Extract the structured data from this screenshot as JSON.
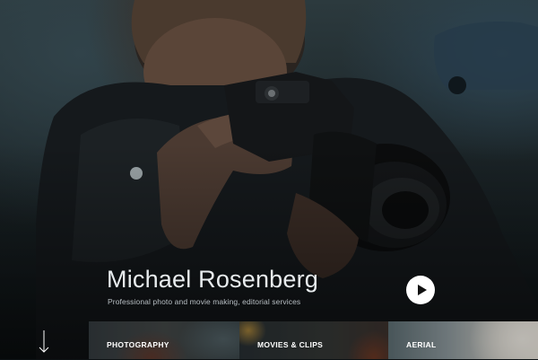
{
  "hero": {
    "name": "Michael Rosenberg",
    "tagline": "Professional photo and movie making, editorial services",
    "play_icon": "play-icon",
    "photo_description_icon": "photographer-with-camera"
  },
  "scroll": {
    "icon": "arrow-down-icon"
  },
  "categories": [
    {
      "label": "PHOTOGRAPHY"
    },
    {
      "label": "MOVIES & CLIPS"
    },
    {
      "label": "AERIAL"
    }
  ],
  "colors": {
    "text_primary": "#ffffff",
    "tagline": "#b7bfc3",
    "play_button_bg": "#ffffff",
    "background_dark": "#0d1214"
  }
}
